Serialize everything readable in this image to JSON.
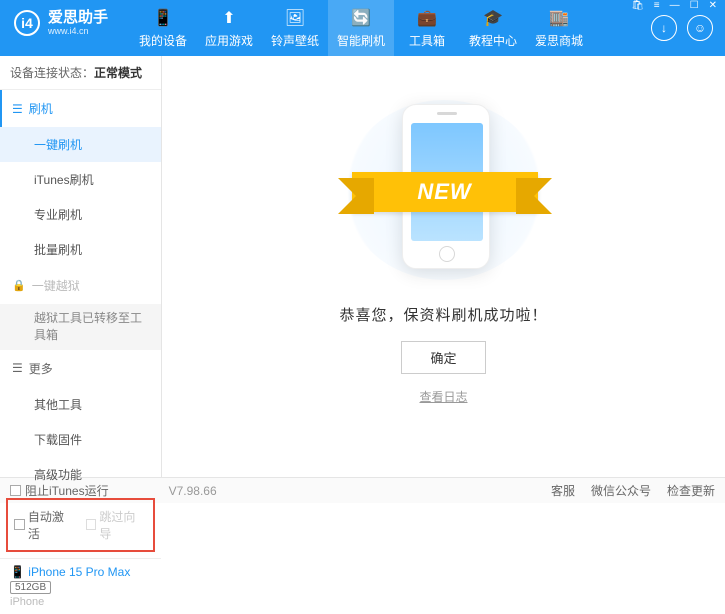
{
  "app": {
    "title": "爱思助手",
    "subtitle": "www.i4.cn"
  },
  "nav": {
    "items": [
      {
        "label": "我的设备"
      },
      {
        "label": "应用游戏"
      },
      {
        "label": "铃声壁纸"
      },
      {
        "label": "智能刷机"
      },
      {
        "label": "工具箱"
      },
      {
        "label": "教程中心"
      },
      {
        "label": "爱思商城"
      }
    ]
  },
  "status": {
    "label": "设备连接状态：",
    "value": "正常模式"
  },
  "sidebar": {
    "group1": {
      "title": "刷机"
    },
    "items1": [
      {
        "label": "一键刷机"
      },
      {
        "label": "iTunes刷机"
      },
      {
        "label": "专业刷机"
      },
      {
        "label": "批量刷机"
      }
    ],
    "group2": {
      "title": "一键越狱"
    },
    "note": "越狱工具已转移至工具箱",
    "group3": {
      "title": "更多"
    },
    "items3": [
      {
        "label": "其他工具"
      },
      {
        "label": "下载固件"
      },
      {
        "label": "高级功能"
      }
    ],
    "checks": {
      "autoActivate": "自动激活",
      "skipGuide": "跳过向导"
    }
  },
  "device": {
    "name": "iPhone 15 Pro Max",
    "storage": "512GB",
    "type": "iPhone"
  },
  "main": {
    "ribbon": "NEW",
    "success": "恭喜您，保资料刷机成功啦！",
    "ok": "确定",
    "viewLog": "查看日志"
  },
  "footer": {
    "blockItunes": "阻止iTunes运行",
    "version": "V7.98.66",
    "links": {
      "cs": "客服",
      "wechat": "微信公众号",
      "update": "检查更新"
    }
  }
}
